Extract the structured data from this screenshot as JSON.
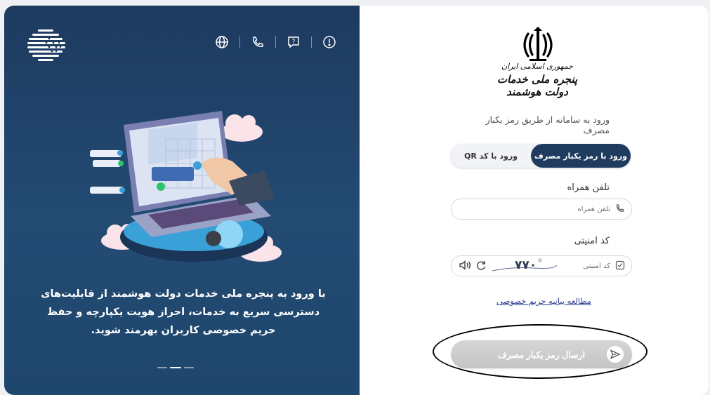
{
  "left_panel": {
    "promo_text": "با ورود به پنجره ملی خدمات دولت هوشمند از قابلیت‌های دسترسی سریع به خدمات، احراز هویت یکپارچه و حفظ حریم خصوصی کاربران بهرمند شوید.",
    "top_icons": [
      "globe-language-icon",
      "phone-icon",
      "help-question-icon",
      "info-icon"
    ],
    "carousel_dots": 3,
    "carousel_active_index": 1
  },
  "right_panel": {
    "brand_line1": "جمهوری اسلامی ایران",
    "brand_line2": "پنجره ملی خدمات دولت هوشمند",
    "subtitle": "ورود به سامانه از طریق رمز یکبار مصرف",
    "tabs": [
      {
        "label": "ورود با رمز یکبار مصرف",
        "active": true
      },
      {
        "label": "ورود با کد QR",
        "active": false
      }
    ],
    "phone_label": "تلفن همراه",
    "phone_placeholder": "تلفن همراه",
    "captcha_label": "کد امنیتی",
    "captcha_placeholder": "کد امنیتی",
    "captcha_image_text": "۷۷۰",
    "privacy_link": "مطالعه بیانیه حریم خصوصی",
    "submit_label": "ارسال رمز یکبار مصرف"
  },
  "colors": {
    "panel_dark": "#1e3a5f",
    "active_tab": "#1f3b5e",
    "link": "#2a3d8f",
    "submit_disabled": "#cccccc"
  }
}
